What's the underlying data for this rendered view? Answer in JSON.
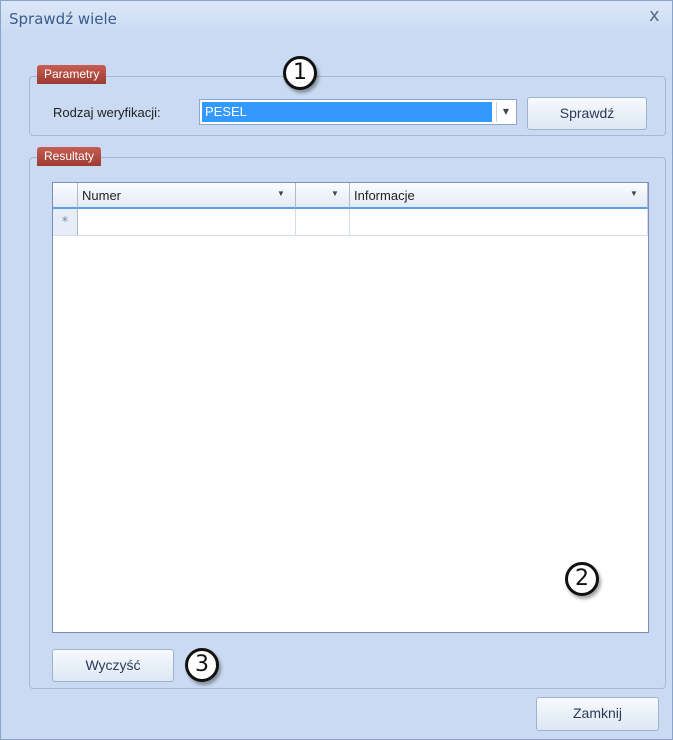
{
  "window": {
    "title": "Sprawdź wiele",
    "close_glyph": "x"
  },
  "parameters": {
    "group_label": "Parametry",
    "verification_label": "Rodzaj weryfikacji:",
    "verification_value": "PESEL",
    "check_button": "Sprawdź"
  },
  "results": {
    "group_label": "Resultaty",
    "columns": [
      "Numer",
      "",
      "Informacje"
    ],
    "new_row_glyph": "*",
    "clear_button": "Wyczyść"
  },
  "footer": {
    "close_button": "Zamknij"
  },
  "callouts": [
    "1",
    "2",
    "3"
  ]
}
